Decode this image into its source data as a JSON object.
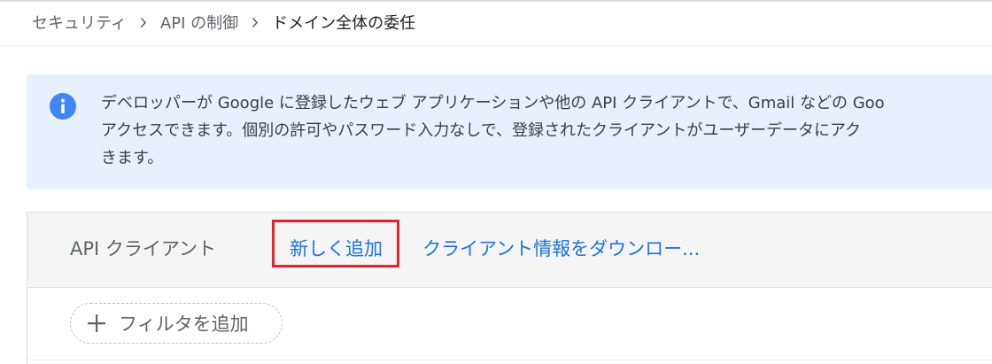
{
  "breadcrumb": {
    "items": [
      {
        "label": "セキュリティ"
      },
      {
        "label": "API の制御"
      },
      {
        "label": "ドメイン全体の委任"
      }
    ],
    "separator_icon": "chevron-right-icon"
  },
  "info_banner": {
    "icon": "info-icon",
    "lines": [
      "デベロッパーが Google に登録したウェブ アプリケーションや他の API クライアントで、Gmail などの Goo",
      "アクセスできます。個別の許可やパスワード入力なしで、登録されたクライアントがユーザーデータにアク",
      "きます。"
    ],
    "background_color": "#e8f0fe",
    "icon_color": "#1a73e8"
  },
  "clients_panel": {
    "title": "API クライアント",
    "add_link": "新しく追加",
    "download_link": "クライアント情報をダウンロー...",
    "filter_chip": {
      "icon": "plus-icon",
      "label": "フィルタを追加"
    },
    "link_color": "#1a73e8",
    "highlight_color": "#e8212e"
  }
}
